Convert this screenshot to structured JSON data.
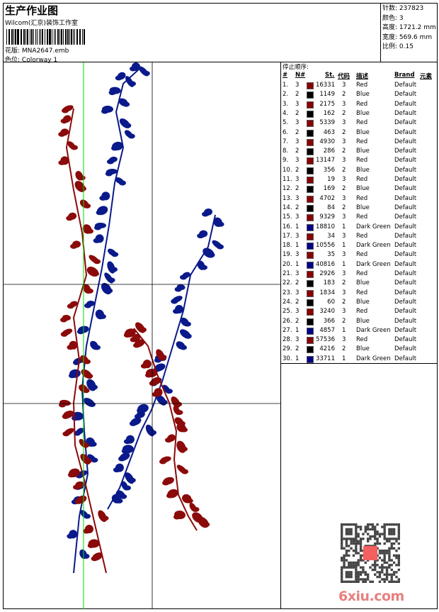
{
  "header": {
    "title": "生产作业图",
    "organization": "Wilcom(汇京)装饰工作室",
    "design_file_label": "花版:",
    "design_file": "MNA2647.emb",
    "colorway_label": "色位:",
    "colorway": "Colorway 1"
  },
  "stats": {
    "stitches_label": "针数:",
    "stitches": "237823",
    "colors_label": "颜色:",
    "colors": "3",
    "height_label": "高度:",
    "height": "1721.2 mm",
    "width_label": "宽度:",
    "width": "569.6 mm",
    "scale_label": "比例:",
    "scale": "0.15"
  },
  "stop_sequence": {
    "caption": "停止顺序:",
    "headers": {
      "num": "#",
      "needle": "N#",
      "stitches": "St.",
      "code": "代码",
      "desc": "描述",
      "brand": "Brand",
      "element": "元素"
    },
    "colors": {
      "Red": "#8b0000",
      "Blue": "#000000",
      "Dark Green": "#00008b"
    },
    "rows": [
      [
        "1.",
        "3",
        "16331",
        "3",
        "Red",
        "Default"
      ],
      [
        "2.",
        "2",
        "1149",
        "2",
        "Blue",
        "Default"
      ],
      [
        "3.",
        "3",
        "2175",
        "3",
        "Red",
        "Default"
      ],
      [
        "4.",
        "2",
        "162",
        "2",
        "Blue",
        "Default"
      ],
      [
        "5.",
        "3",
        "5339",
        "3",
        "Red",
        "Default"
      ],
      [
        "6.",
        "2",
        "463",
        "2",
        "Blue",
        "Default"
      ],
      [
        "7.",
        "3",
        "4930",
        "3",
        "Red",
        "Default"
      ],
      [
        "8.",
        "2",
        "286",
        "2",
        "Blue",
        "Default"
      ],
      [
        "9.",
        "3",
        "13147",
        "3",
        "Red",
        "Default"
      ],
      [
        "10.",
        "2",
        "356",
        "2",
        "Blue",
        "Default"
      ],
      [
        "11.",
        "3",
        "19",
        "3",
        "Red",
        "Default"
      ],
      [
        "12.",
        "2",
        "169",
        "2",
        "Blue",
        "Default"
      ],
      [
        "13.",
        "3",
        "4702",
        "3",
        "Red",
        "Default"
      ],
      [
        "14.",
        "2",
        "84",
        "2",
        "Blue",
        "Default"
      ],
      [
        "15.",
        "3",
        "9329",
        "3",
        "Red",
        "Default"
      ],
      [
        "16.",
        "1",
        "18810",
        "1",
        "Dark Green",
        "Default"
      ],
      [
        "17.",
        "3",
        "34",
        "3",
        "Red",
        "Default"
      ],
      [
        "18.",
        "1",
        "10556",
        "1",
        "Dark Green",
        "Default"
      ],
      [
        "19.",
        "3",
        "35",
        "3",
        "Red",
        "Default"
      ],
      [
        "20.",
        "1",
        "40816",
        "1",
        "Dark Green",
        "Default"
      ],
      [
        "21.",
        "3",
        "2926",
        "3",
        "Red",
        "Default"
      ],
      [
        "22.",
        "2",
        "183",
        "2",
        "Blue",
        "Default"
      ],
      [
        "23.",
        "3",
        "1834",
        "3",
        "Red",
        "Default"
      ],
      [
        "24.",
        "2",
        "60",
        "2",
        "Blue",
        "Default"
      ],
      [
        "25.",
        "3",
        "3240",
        "3",
        "Red",
        "Default"
      ],
      [
        "26.",
        "2",
        "366",
        "2",
        "Blue",
        "Default"
      ],
      [
        "27.",
        "1",
        "4857",
        "1",
        "Dark Green",
        "Default"
      ],
      [
        "28.",
        "3",
        "57536",
        "3",
        "Red",
        "Default"
      ],
      [
        "29.",
        "2",
        "4216",
        "2",
        "Blue",
        "Default"
      ],
      [
        "30.",
        "1",
        "33711",
        "1",
        "Dark Green",
        "Default"
      ]
    ]
  },
  "design_colors": {
    "red": "#8b0a0a",
    "blue": "#0a1a8b",
    "guide_green": "#00dd00"
  },
  "watermark": "6xiu.com"
}
